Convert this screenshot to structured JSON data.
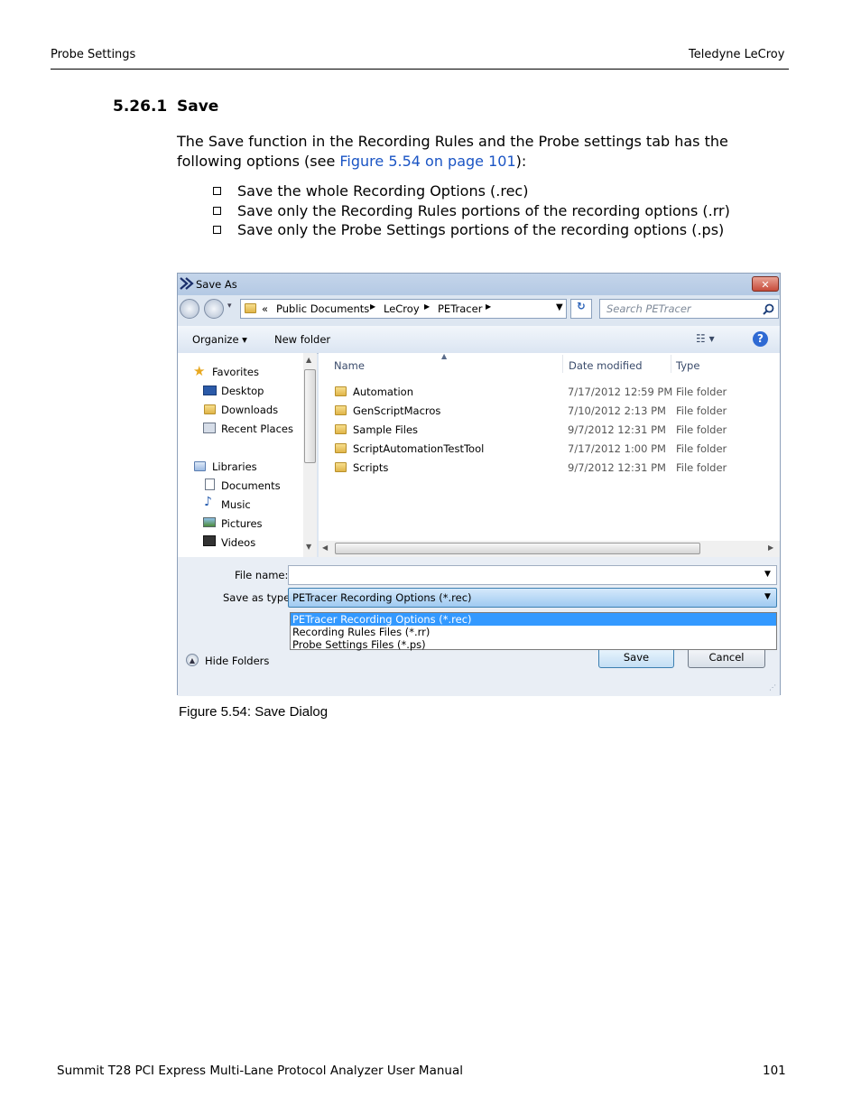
{
  "header": {
    "left": "Probe Settings",
    "right": "Teledyne LeCroy"
  },
  "section": {
    "number": "5.26.1",
    "title": "Save"
  },
  "paragraph": {
    "before": "The Save function in the Recording Rules and the Probe settings tab has the following options (see ",
    "link": "Figure 5.54 on page 101",
    "after": "):"
  },
  "bullets": [
    "Save the whole Recording Options (.rec)",
    "Save only the Recording Rules portions of the recording options (.rr)",
    "Save only the Probe Settings portions of the recording options (.ps)"
  ],
  "dialog": {
    "title": "Save As",
    "close": "✕",
    "address": {
      "prefix": "«",
      "crumbs": [
        "Public Documents",
        "LeCroy",
        "PETracer"
      ]
    },
    "search_placeholder": "Search PETracer",
    "toolbar": {
      "organize": "Organize ▾",
      "new_folder": "New folder"
    },
    "nav": {
      "favorites": "Favorites",
      "favorites_items": [
        "Desktop",
        "Downloads",
        "Recent Places"
      ],
      "libraries": "Libraries",
      "library_items": [
        "Documents",
        "Music",
        "Pictures",
        "Videos"
      ]
    },
    "columns": [
      "Name",
      "Date modified",
      "Type"
    ],
    "files": [
      {
        "name": "Automation",
        "date": "7/17/2012 12:59 PM",
        "type": "File folder"
      },
      {
        "name": "GenScriptMacros",
        "date": "7/10/2012 2:13 PM",
        "type": "File folder"
      },
      {
        "name": "Sample Files",
        "date": "9/7/2012 12:31 PM",
        "type": "File folder"
      },
      {
        "name": "ScriptAutomationTestTool",
        "date": "7/17/2012 1:00 PM",
        "type": "File folder"
      },
      {
        "name": "Scripts",
        "date": "9/7/2012 12:31 PM",
        "type": "File folder"
      }
    ],
    "file_name_label": "File name:",
    "file_name_value": "",
    "save_type_label": "Save as type:",
    "save_type_value": "PETracer Recording Options (*.rec)",
    "save_type_options": [
      "PETracer Recording Options (*.rec)",
      "Recording Rules Files (*.rr)",
      "Probe Settings Files (*.ps)"
    ],
    "hide_folders": "Hide Folders",
    "save_button": "Save",
    "cancel_button": "Cancel"
  },
  "caption": "Figure 5.54:  Save Dialog",
  "footer": {
    "left": "Summit T28 PCI Express Multi-Lane Protocol Analyzer User Manual",
    "right": "101"
  }
}
